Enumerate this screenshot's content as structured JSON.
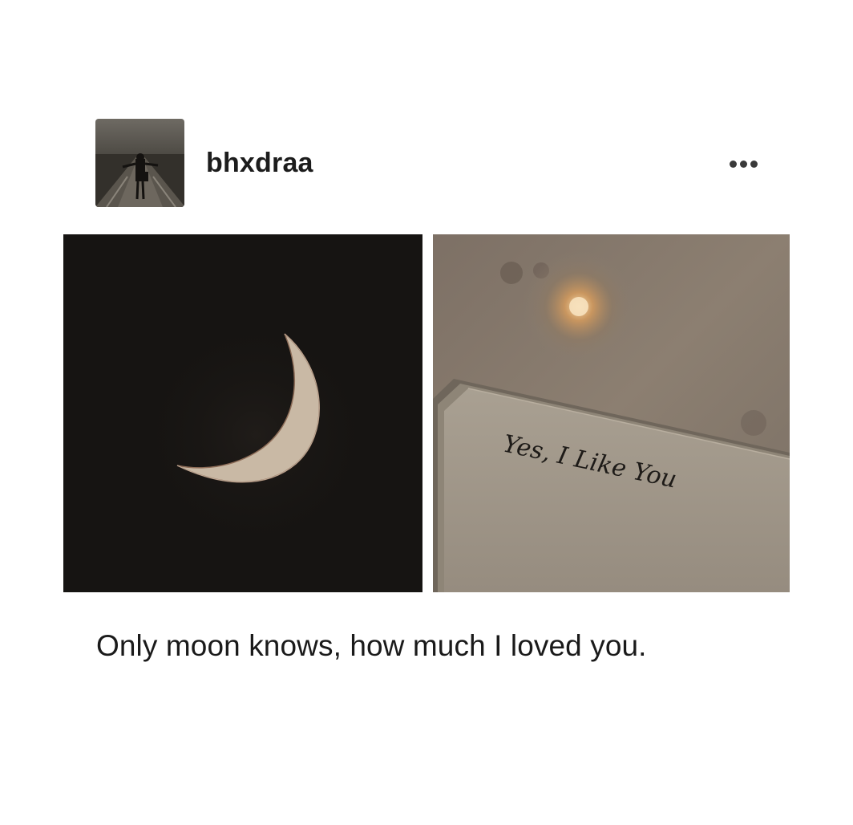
{
  "post": {
    "author": {
      "username": "bhxdraa",
      "avatar_icon": "person-on-road-avatar"
    },
    "more_icon": "more-horizontal-icon",
    "photos": [
      {
        "name": "moon-photo",
        "description_icon": "crescent-moon-image"
      },
      {
        "name": "note-photo",
        "note_text": "Yes, I Like You"
      }
    ],
    "caption": "Only moon knows, how much I loved you."
  },
  "colors": {
    "background": "#ffffff",
    "text": "#1a1a1a",
    "moon_sky": "#161412",
    "moon": "#c9b9a5",
    "paper": "#a59b8d"
  }
}
